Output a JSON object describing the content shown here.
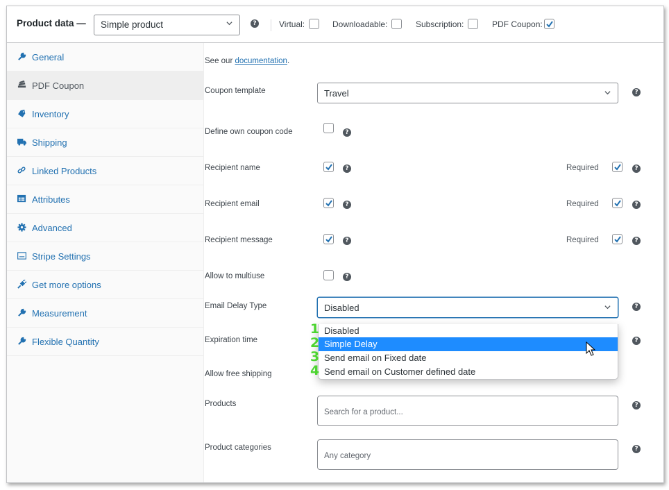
{
  "header": {
    "title": "Product data —",
    "product_type": "Simple product",
    "options": [
      {
        "label": "Virtual:",
        "checked": false
      },
      {
        "label": "Downloadable:",
        "checked": false
      },
      {
        "label": "Subscription:",
        "checked": false
      },
      {
        "label": "PDF Coupon:",
        "checked": true
      }
    ]
  },
  "sidebar": {
    "active": "PDF Coupon",
    "items": [
      {
        "label": "General",
        "icon": "wrench-icon"
      },
      {
        "label": "PDF Coupon",
        "icon": "coupon-stack-icon"
      },
      {
        "label": "Inventory",
        "icon": "tag-icon"
      },
      {
        "label": "Shipping",
        "icon": "truck-icon"
      },
      {
        "label": "Linked Products",
        "icon": "link-icon"
      },
      {
        "label": "Attributes",
        "icon": "list-card-icon"
      },
      {
        "label": "Advanced",
        "icon": "gear-icon"
      },
      {
        "label": "Stripe Settings",
        "icon": "card-icon"
      },
      {
        "label": "Get more options",
        "icon": "plug-icon"
      },
      {
        "label": "Measurement",
        "icon": "wrench-icon"
      },
      {
        "label": "Flexible Quantity",
        "icon": "wrench-icon"
      }
    ]
  },
  "main": {
    "doc_prefix": "See our ",
    "doc_link": "documentation",
    "doc_suffix": ".",
    "coupon_template": {
      "label": "Coupon template",
      "value": "Travel"
    },
    "define_own_code": {
      "label": "Define own coupon code",
      "checked": false
    },
    "recipient_name": {
      "label": "Recipient name",
      "checked": true,
      "required_label": "Required",
      "required": true
    },
    "recipient_email": {
      "label": "Recipient email",
      "checked": true,
      "required_label": "Required",
      "required": true
    },
    "recipient_message": {
      "label": "Recipient message",
      "checked": true,
      "required_label": "Required",
      "required": true
    },
    "allow_multiuse": {
      "label": "Allow to multiuse",
      "checked": false
    },
    "email_delay_type": {
      "label": "Email Delay Type",
      "value": "Disabled",
      "options": [
        "Disabled",
        "Simple Delay",
        "Send email on Fixed date",
        "Send email on Customer defined date"
      ],
      "highlighted": "Simple Delay",
      "markers": [
        "1",
        "2",
        "3",
        "4"
      ]
    },
    "expiration_time": {
      "label": "Expiration time"
    },
    "allow_free_shipping": {
      "label": "Allow free shipping",
      "checked": false
    },
    "products": {
      "label": "Products",
      "placeholder": "Search for a product..."
    },
    "product_categories": {
      "label": "Product categories",
      "placeholder": "Any category"
    }
  },
  "colors": {
    "accent": "#2271b1",
    "highlight": "#1e8cff",
    "marker_green": "#4cd430"
  }
}
